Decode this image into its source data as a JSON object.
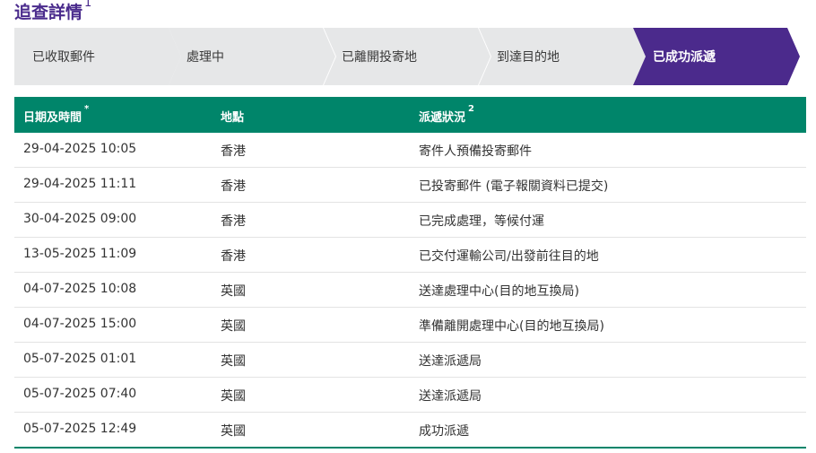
{
  "page": {
    "title": "追查詳情",
    "title_note": "1"
  },
  "steps": [
    "已收取郵件",
    "處理中",
    "已離開投寄地",
    "到達目的地",
    "已成功派遞"
  ],
  "active_step": 4,
  "colors": {
    "title": "#4a2b8c",
    "active_step": "#4b2a8c",
    "step": "#e6e7e8",
    "header": "#00856a"
  },
  "table": {
    "headers": {
      "datetime": "日期及時間",
      "datetime_note": "*",
      "location": "地點",
      "status": "派遞狀況",
      "status_note": "2"
    },
    "rows": [
      {
        "datetime": "29-04-2025 10:05",
        "location": "香港",
        "status": "寄件人預備投寄郵件"
      },
      {
        "datetime": "29-04-2025 11:11",
        "location": "香港",
        "status": "已投寄郵件 (電子報關資料已提交)"
      },
      {
        "datetime": "30-04-2025 09:00",
        "location": "香港",
        "status": "已完成處理，等候付運"
      },
      {
        "datetime": "13-05-2025 11:09",
        "location": "香港",
        "status": "已交付運輸公司/出發前往目的地"
      },
      {
        "datetime": "04-07-2025 10:08",
        "location": "英國",
        "status": "送達處理中心(目的地互換局)"
      },
      {
        "datetime": "04-07-2025 15:00",
        "location": "英國",
        "status": "準備離開處理中心(目的地互換局)"
      },
      {
        "datetime": "05-07-2025 01:01",
        "location": "英國",
        "status": "送達派遞局"
      },
      {
        "datetime": "05-07-2025 07:40",
        "location": "英國",
        "status": "送達派遞局"
      },
      {
        "datetime": "05-07-2025 12:49",
        "location": "英國",
        "status": "成功派遞"
      }
    ]
  }
}
